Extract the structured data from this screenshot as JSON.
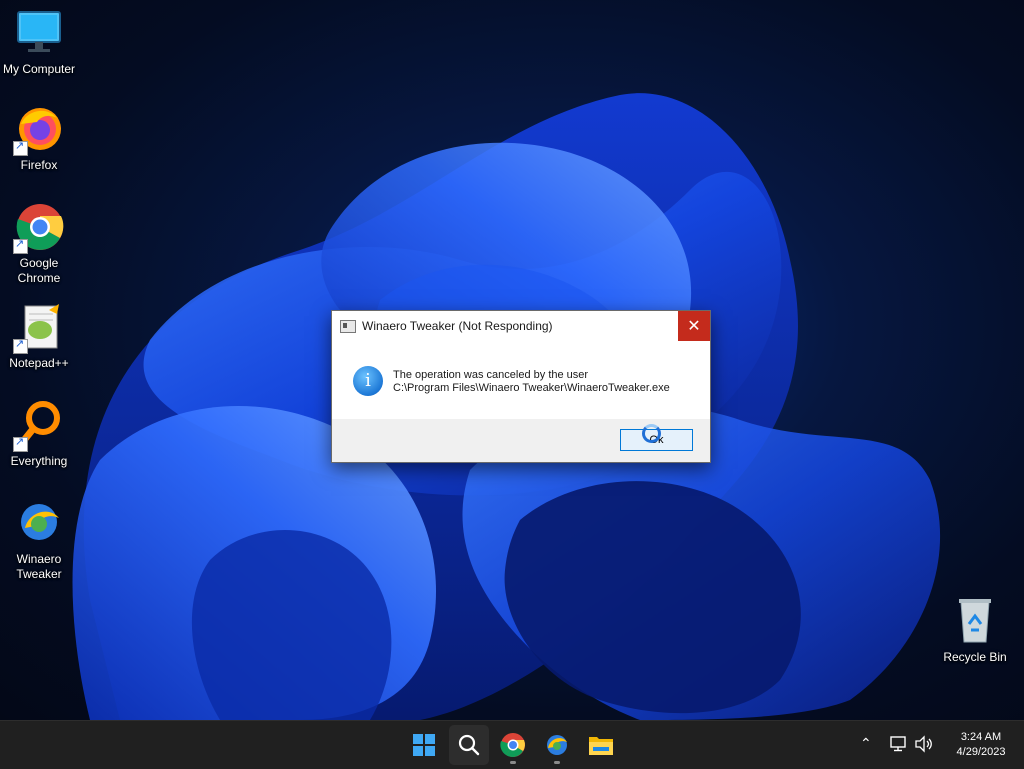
{
  "desktop": {
    "icons": [
      {
        "label": "My Computer",
        "icon": "monitor-icon"
      },
      {
        "label": "Firefox",
        "icon": "firefox-icon"
      },
      {
        "label": "Google Chrome",
        "icon": "chrome-icon"
      },
      {
        "label": "Notepad++",
        "icon": "notepadpp-icon"
      },
      {
        "label": "Everything",
        "icon": "search-magnifier-icon"
      },
      {
        "label": "Winaero Tweaker",
        "icon": "winaero-tweaker-icon"
      },
      {
        "label": "Recycle Bin",
        "icon": "recycle-bin-icon"
      }
    ]
  },
  "dialog": {
    "title": "Winaero Tweaker (Not Responding)",
    "close_label": "✕",
    "message_line1": "The operation was canceled by the user",
    "message_line2": "C:\\Program Files\\Winaero Tweaker\\WinaeroTweaker.exe",
    "ok_label": "Ok",
    "icon": "info-icon"
  },
  "taskbar": {
    "apps": [
      "start-icon",
      "search-icon",
      "chrome-icon",
      "winaero-tweaker-icon",
      "file-explorer-icon"
    ],
    "time": "3:24 AM",
    "date": "4/29/2023"
  },
  "colors": {
    "taskbar": "#202020",
    "close_button": "#c42b1c",
    "accent": "#0078d7"
  }
}
